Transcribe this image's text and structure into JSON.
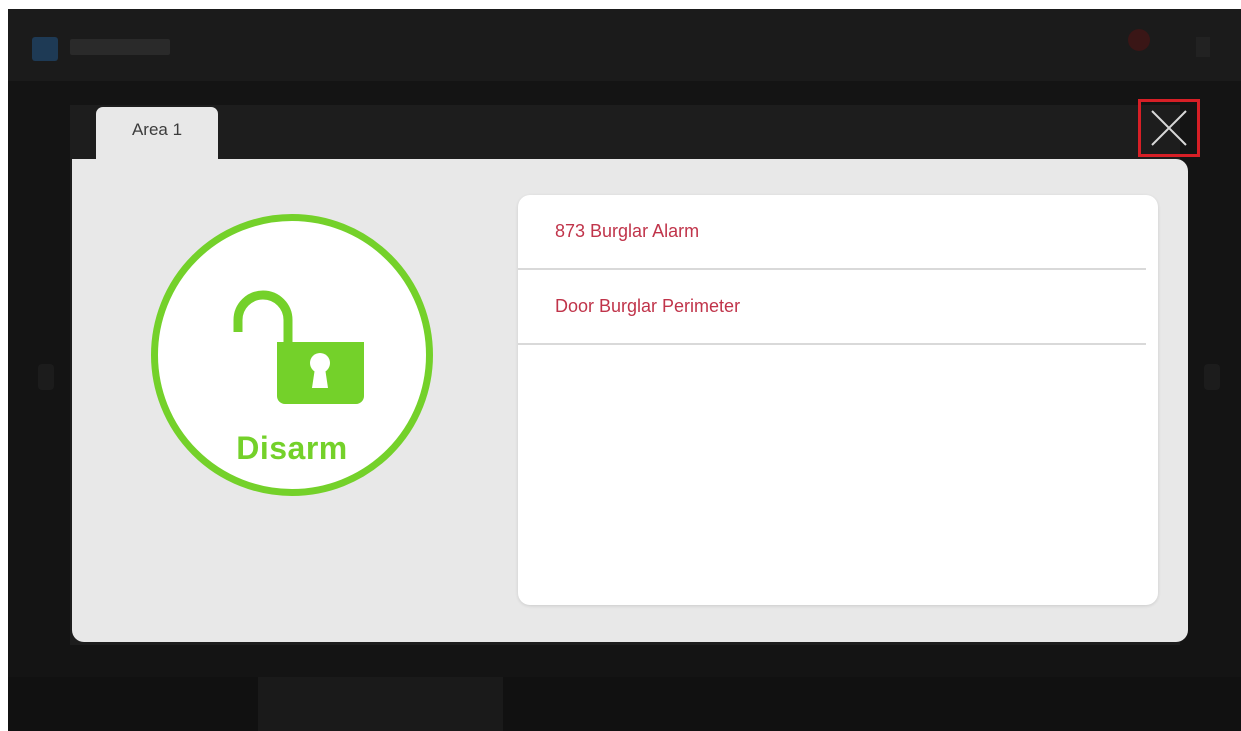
{
  "background_app": {
    "title": "",
    "colors": {
      "topbar": "#1b1b1b",
      "screen": "#141414"
    }
  },
  "area_tab": {
    "label": "Area 1"
  },
  "close_button": {
    "icon": "close-icon",
    "highlight_color": "#d71f26"
  },
  "status": {
    "label": "Disarm",
    "icon": "unlocked-padlock-icon",
    "color": "#74d12a"
  },
  "alarms": {
    "text_color": "#c0344a",
    "items": [
      {
        "label": "873  Burglar Alarm"
      },
      {
        "label": "Door Burglar Perimeter"
      }
    ]
  }
}
